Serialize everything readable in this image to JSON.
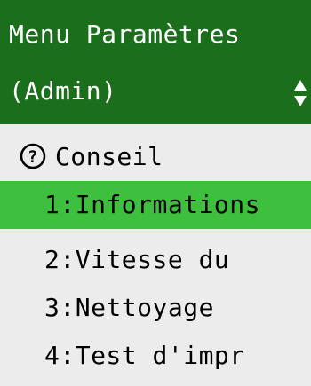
{
  "header": {
    "title": "Menu Paramètres",
    "subtitle": "(Admin)",
    "scroll_icon": "up-down-arrows-icon"
  },
  "tip": {
    "icon": "question-circle-icon",
    "label": "Conseil"
  },
  "items": [
    {
      "label": "1:Informations",
      "selected": true
    },
    {
      "label": "2:Vitesse du",
      "selected": false
    },
    {
      "label": "3:Nettoyage",
      "selected": false
    },
    {
      "label": "4:Test d'impr",
      "selected": false
    }
  ],
  "colors": {
    "header_bg": "#1b6e1c",
    "selected_bg": "#3ebf3e",
    "list_bg": "#ececec"
  }
}
